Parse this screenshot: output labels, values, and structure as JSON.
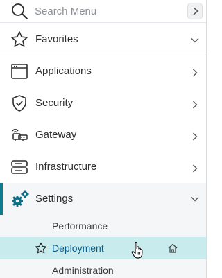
{
  "search": {
    "placeholder": "Search Menu",
    "icon": "search-icon",
    "go_icon": "chevron-right-icon"
  },
  "favorites": {
    "label": "Favorites",
    "icon": "star-icon",
    "chevron": "chevron-down-icon"
  },
  "nav_items": [
    {
      "label": "Applications",
      "icon": "applications-window-icon",
      "chevron": "chevron-right-icon"
    },
    {
      "label": "Security",
      "icon": "shield-check-icon",
      "chevron": "chevron-right-icon"
    },
    {
      "label": "Gateway",
      "icon": "gateway-icon",
      "chevron": "chevron-right-icon"
    },
    {
      "label": "Infrastructure",
      "icon": "server-icon",
      "chevron": "chevron-right-icon"
    }
  ],
  "settings": {
    "label": "Settings",
    "icon": "gears-icon",
    "chevron": "chevron-down-icon",
    "expanded": true,
    "accent_color": "#0d7c8f",
    "sub_items": [
      {
        "label": "Performance"
      },
      {
        "label": "Deployment",
        "selected": true,
        "highlight_color": "#c8ecee",
        "favorite_icon": "star-outline-icon",
        "home_icon": "home-icon"
      },
      {
        "label": "Administration"
      }
    ]
  },
  "colors": {
    "text": "#2d2d2d",
    "selected_text": "#0b5c88",
    "divider": "#e3e6ea"
  }
}
